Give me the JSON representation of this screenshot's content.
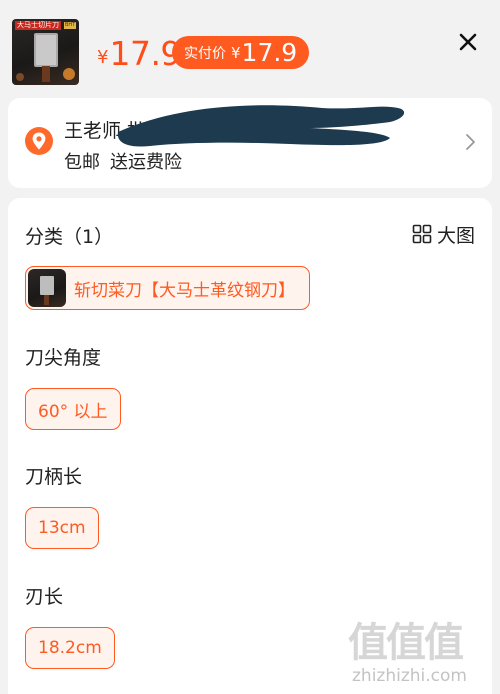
{
  "header": {
    "thumbnail": {
      "label": "大马士切片刀",
      "badge": "BHT"
    },
    "price": {
      "currency": "¥",
      "value": "17.9"
    },
    "actual_price": {
      "label": "实付价",
      "currency": "¥",
      "value": "17.9"
    },
    "close_icon": "close-icon"
  },
  "address": {
    "name": "王老师 批发",
    "tags": [
      "包邮",
      "送运费险"
    ],
    "icon": "location-pin-icon",
    "chevron_icon": "chevron-right-icon"
  },
  "spec": {
    "category_title": "分类（1）",
    "big_view_label": "大图",
    "big_view_icon": "grid-icon",
    "category_options": [
      {
        "label": "斩切菜刀【大马士革纹钢刀】",
        "selected": true
      }
    ],
    "sections": [
      {
        "title": "刀尖角度",
        "options": [
          "60° 以上"
        ]
      },
      {
        "title": "刀柄长",
        "options": [
          "13cm"
        ]
      },
      {
        "title": "刃长",
        "options": [
          "18.2cm"
        ]
      }
    ]
  },
  "watermark": {
    "glyphs": "值值值",
    "url": "zhizhizhi.com"
  },
  "colors": {
    "accent": "#ff5a1f",
    "price": "#ff4d1a",
    "address_redaction": "#1d3a4f",
    "background": "#f2f2f2"
  }
}
